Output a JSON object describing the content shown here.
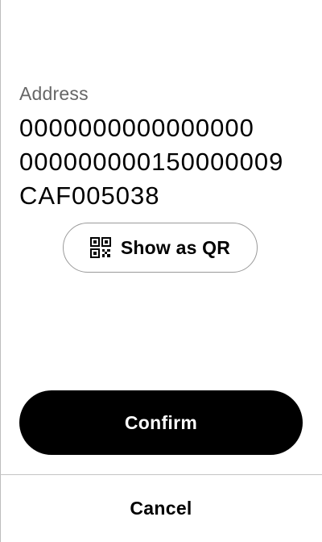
{
  "address": {
    "label": "Address",
    "lines": [
      "0000000000000000",
      "000000000150000009",
      "CAF005038"
    ]
  },
  "qr_button": {
    "label": "Show as QR",
    "icon": "qr-code-icon"
  },
  "confirm_button": {
    "label": "Confirm"
  },
  "cancel_button": {
    "label": "Cancel"
  },
  "colors": {
    "background": "#ffffff",
    "primary": "#000000",
    "label_gray": "#666666",
    "border_gray": "#9a9a9a"
  }
}
